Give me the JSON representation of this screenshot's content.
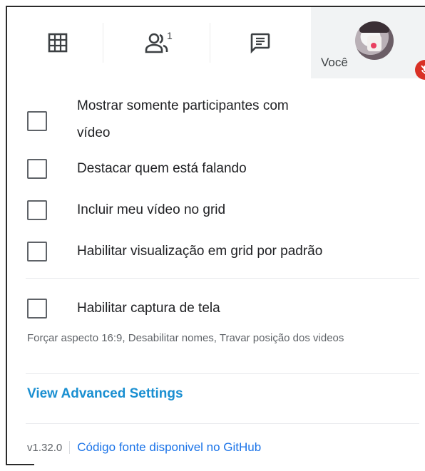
{
  "toolbar": {
    "people_count": "1",
    "self_name": "Você"
  },
  "options": [
    {
      "label_line1": "Mostrar somente participantes com",
      "label_line2": "vídeo",
      "checked": false
    },
    {
      "label": "Destacar quem está falando",
      "checked": false
    },
    {
      "label": "Incluir meu vídeo no grid",
      "checked": false
    },
    {
      "label": "Habilitar visualização em grid por padrão",
      "checked": false
    },
    {
      "label": "Habilitar captura de tela",
      "checked": false
    }
  ],
  "hint": "Forçar aspecto 16:9, Desabilitar nomes, Travar posição dos videos",
  "advanced_link": "View Advanced Settings",
  "footer": {
    "version": "v1.32.0",
    "source_link": "Código fonte disponivel no GitHub"
  },
  "colors": {
    "link": "#1a8fd1",
    "mic_muted": "#d93025",
    "text": "#202124",
    "muted_text": "#5f6368"
  }
}
